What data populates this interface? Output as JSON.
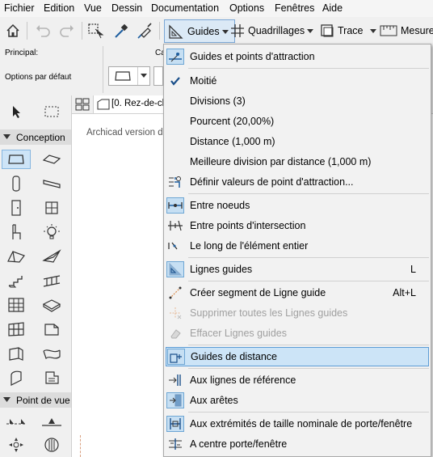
{
  "menubar": [
    "Fichier",
    "Edition",
    "Vue",
    "Dessin",
    "Documentation",
    "Options",
    "Fenêtres",
    "Aide"
  ],
  "toolbar": {
    "guides_label": "Guides",
    "grids_label": "Quadrillages",
    "trace_label": "Trace",
    "measure_label": "Mesure"
  },
  "infobox": {
    "principal_label": "Principal:",
    "defaults_label": "Options par défaut",
    "partial_label": "Ca"
  },
  "toolbox": {
    "section_design": "Conception",
    "section_view": "Point de vue"
  },
  "canvas": {
    "tab_label": "[0. Rez-de-ch",
    "version_text": "Archicad version dé"
  },
  "menu": {
    "items": [
      {
        "label": "Guides et points d'attraction",
        "icon": "snap-guides-icon"
      },
      {
        "label": "Moitié",
        "icon": "checkmark-icon"
      },
      {
        "label": "Divisions (3)",
        "icon": ""
      },
      {
        "label": "Pourcent (20,00%)",
        "icon": ""
      },
      {
        "label": "Distance (1,000 m)",
        "icon": ""
      },
      {
        "label": "Meilleure division par distance (1,000 m)",
        "icon": ""
      },
      {
        "label": "Définir valeurs de point d'attraction...",
        "icon": "snap-settings-icon"
      },
      {
        "label": "Entre noeuds",
        "icon": "between-nodes-icon"
      },
      {
        "label": "Entre points d'intersection",
        "icon": "intersection-points-icon"
      },
      {
        "label": "Le long de l'élément entier",
        "icon": "whole-element-icon"
      },
      {
        "label": "Lignes guides",
        "icon": "guide-lines-icon",
        "shortcut": "L"
      },
      {
        "label": "Créer segment de Ligne guide",
        "icon": "create-guide-segment-icon",
        "shortcut": "Alt+L"
      },
      {
        "label": "Supprimer toutes les Lignes guides",
        "icon": "remove-guides-icon"
      },
      {
        "label": "Effacer Lignes guides",
        "icon": "erase-guides-icon"
      },
      {
        "label": "Guides de distance",
        "icon": "distance-guides-icon"
      },
      {
        "label": "Aux lignes de référence",
        "icon": "reference-lines-icon"
      },
      {
        "label": "Aux arêtes",
        "icon": "edges-icon"
      },
      {
        "label": "Aux extrémités de taille nominale de porte/fenêtre",
        "icon": "door-window-ends-icon"
      },
      {
        "label": "A centre porte/fenêtre",
        "icon": "door-window-center-icon"
      }
    ]
  },
  "colors": {
    "highlight_bg": "#cce4f7",
    "highlight_border": "#5b9bd5",
    "icon_blue": "#1f5fa0"
  }
}
